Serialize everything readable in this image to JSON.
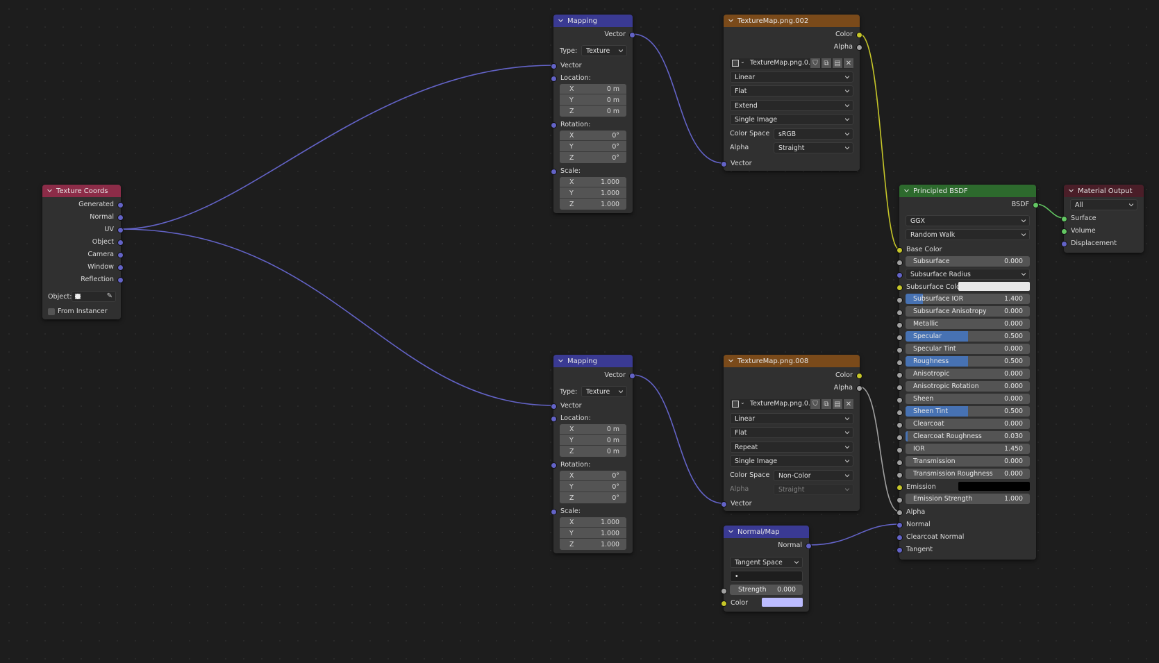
{
  "editor": {
    "type": "Shader Node Editor"
  },
  "colors": {
    "texcoord_header": "#8c2c48",
    "mapping_header": "#3a3a93",
    "image_header": "#7a4a1a",
    "bsdf_header": "#2d6a2d",
    "output_header": "#4a1e28",
    "normalmap_header": "#3a3a93",
    "vector_socket": "#6363c7",
    "color_socket": "#c7c729",
    "float_socket": "#a1a1a1",
    "shader_socket": "#63c763",
    "slider_fill": "#4772b3",
    "subsurface_color": "#e8e8e8",
    "emission_color": "#000000",
    "normalmap_color": "#bcbcff"
  },
  "texture_coords": {
    "title": "Texture Coords",
    "outputs": [
      "Generated",
      "Normal",
      "UV",
      "Object",
      "Camera",
      "Window",
      "Reflection"
    ],
    "object_label": "Object:",
    "object_value": "",
    "from_instancer_label": "From Instancer",
    "from_instancer_checked": false
  },
  "mapping_1": {
    "title": "Mapping",
    "output": "Vector",
    "type_label": "Type:",
    "type_value": "Texture",
    "vector_label": "Vector",
    "location_label": "Location:",
    "location": [
      {
        "k": "X",
        "v": "0 m"
      },
      {
        "k": "Y",
        "v": "0 m"
      },
      {
        "k": "Z",
        "v": "0 m"
      }
    ],
    "rotation_label": "Rotation:",
    "rotation": [
      {
        "k": "X",
        "v": "0°"
      },
      {
        "k": "Y",
        "v": "0°"
      },
      {
        "k": "Z",
        "v": "0°"
      }
    ],
    "scale_label": "Scale:",
    "scale": [
      {
        "k": "X",
        "v": "1.000"
      },
      {
        "k": "Y",
        "v": "1.000"
      },
      {
        "k": "Z",
        "v": "1.000"
      }
    ]
  },
  "mapping_2": {
    "title": "Mapping",
    "output": "Vector",
    "type_label": "Type:",
    "type_value": "Texture",
    "vector_label": "Vector",
    "location_label": "Location:",
    "location": [
      {
        "k": "X",
        "v": "0 m"
      },
      {
        "k": "Y",
        "v": "0 m"
      },
      {
        "k": "Z",
        "v": "0 m"
      }
    ],
    "rotation_label": "Rotation:",
    "rotation": [
      {
        "k": "X",
        "v": "0°"
      },
      {
        "k": "Y",
        "v": "0°"
      },
      {
        "k": "Z",
        "v": "0°"
      }
    ],
    "scale_label": "Scale:",
    "scale": [
      {
        "k": "X",
        "v": "1.000"
      },
      {
        "k": "Y",
        "v": "1.000"
      },
      {
        "k": "Z",
        "v": "1.000"
      }
    ]
  },
  "image_1": {
    "title": "TextureMap.png.002",
    "outputs": [
      "Color",
      "Alpha"
    ],
    "image_name": "TextureMap.png.0...",
    "interpolation": "Linear",
    "projection": "Flat",
    "extension": "Extend",
    "source": "Single Image",
    "color_space_label": "Color Space",
    "color_space": "sRGB",
    "alpha_label": "Alpha",
    "alpha": "Straight",
    "input": "Vector"
  },
  "image_2": {
    "title": "TextureMap.png.008",
    "outputs": [
      "Color",
      "Alpha"
    ],
    "image_name": "TextureMap.png.0...",
    "interpolation": "Linear",
    "projection": "Flat",
    "extension": "Repeat",
    "source": "Single Image",
    "color_space_label": "Color Space",
    "color_space": "Non-Color",
    "alpha_label": "Alpha",
    "alpha": "Straight",
    "input": "Vector"
  },
  "normal_map": {
    "title": "Normal/Map",
    "output": "Normal",
    "space": "Tangent Space",
    "uv_map": "•",
    "strength_label": "Strength",
    "strength": "0.000",
    "color_label": "Color"
  },
  "bsdf": {
    "title": "Principled BSDF",
    "output": "BSDF",
    "distribution": "GGX",
    "subsurface_method": "Random Walk",
    "base_color_label": "Base Color",
    "subsurface_radius_label": "Subsurface Radius",
    "subsurface_color_label": "Subsurface Color",
    "emission_label": "Emission",
    "alpha_label": "Alpha",
    "normal_label": "Normal",
    "clearcoat_normal_label": "Clearcoat Normal",
    "tangent_label": "Tangent",
    "sliders": [
      {
        "label": "Subsurface",
        "value": "0.000",
        "fraction": 0
      },
      {
        "label": "Subsurface IOR",
        "value": "1.400",
        "fraction": 0.14
      },
      {
        "label": "Subsurface Anisotropy",
        "value": "0.000",
        "fraction": 0
      },
      {
        "label": "Metallic",
        "value": "0.000",
        "fraction": 0
      },
      {
        "label": "Specular",
        "value": "0.500",
        "fraction": 0.5
      },
      {
        "label": "Specular Tint",
        "value": "0.000",
        "fraction": 0
      },
      {
        "label": "Roughness",
        "value": "0.500",
        "fraction": 0.5
      },
      {
        "label": "Anisotropic",
        "value": "0.000",
        "fraction": 0
      },
      {
        "label": "Anisotropic Rotation",
        "value": "0.000",
        "fraction": 0
      },
      {
        "label": "Sheen",
        "value": "0.000",
        "fraction": 0
      },
      {
        "label": "Sheen Tint",
        "value": "0.500",
        "fraction": 0.5
      },
      {
        "label": "Clearcoat",
        "value": "0.000",
        "fraction": 0
      },
      {
        "label": "Clearcoat Roughness",
        "value": "0.030",
        "fraction": 0.03
      },
      {
        "label": "IOR",
        "value": "1.450",
        "fraction": 0
      },
      {
        "label": "Transmission",
        "value": "0.000",
        "fraction": 0
      },
      {
        "label": "Transmission Roughness",
        "value": "0.000",
        "fraction": 0
      },
      {
        "label": "Emission Strength",
        "value": "1.000",
        "fraction": 0
      }
    ]
  },
  "material_output": {
    "title": "Material Output",
    "target": "All",
    "inputs": [
      "Surface",
      "Volume",
      "Displacement"
    ]
  }
}
